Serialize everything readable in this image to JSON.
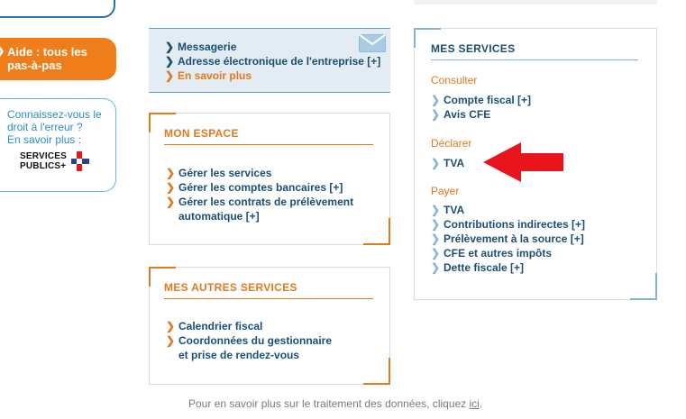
{
  "help": {
    "label_line1": "Aide : tous les",
    "label_line2": "pas-à-pas"
  },
  "error_box": {
    "line1": "Connaissez-vous le",
    "line2": "droit à l'erreur ?",
    "line3": "En savoir plus :",
    "logo_line1": "SERVICES",
    "logo_line2": "PUBLICS+"
  },
  "messaging": {
    "items": [
      "Messagerie",
      "Adresse électronique de l'entreprise [+]",
      "En savoir plus"
    ]
  },
  "mon_espace": {
    "title": "MON ESPACE",
    "items": [
      "Gérer les services",
      "Gérer les comptes bancaires [+]",
      "Gérer les contrats de prélèvement",
      "automatique [+]"
    ]
  },
  "mes_autres_services": {
    "title": "MES AUTRES SERVICES",
    "items": [
      "Calendrier fiscal",
      "Coordonnées du gestionnaire",
      "et prise de rendez-vous"
    ]
  },
  "mes_services": {
    "title": "MES SERVICES",
    "consulter": {
      "label": "Consulter",
      "items": [
        "Compte fiscal [+]",
        "Avis CFE"
      ]
    },
    "declarer": {
      "label": "Déclarer",
      "items": [
        "TVA"
      ]
    },
    "payer": {
      "label": "Payer",
      "items": [
        "TVA",
        "Contributions indirectes [+]",
        "Prélèvement à la source [+]",
        "CFE et autres impôts",
        "Dette fiscale [+]"
      ]
    }
  },
  "footer": {
    "text": "Pour en savoir plus sur le traitement des données, cliquez",
    "link": "ici",
    "end": "."
  },
  "colors": {
    "orange": "#e07a1f",
    "help_orange": "#ef7d1a",
    "navy": "#1b4f72",
    "light_blue": "#7fb3d1",
    "arrow_red": "#e8141b"
  }
}
